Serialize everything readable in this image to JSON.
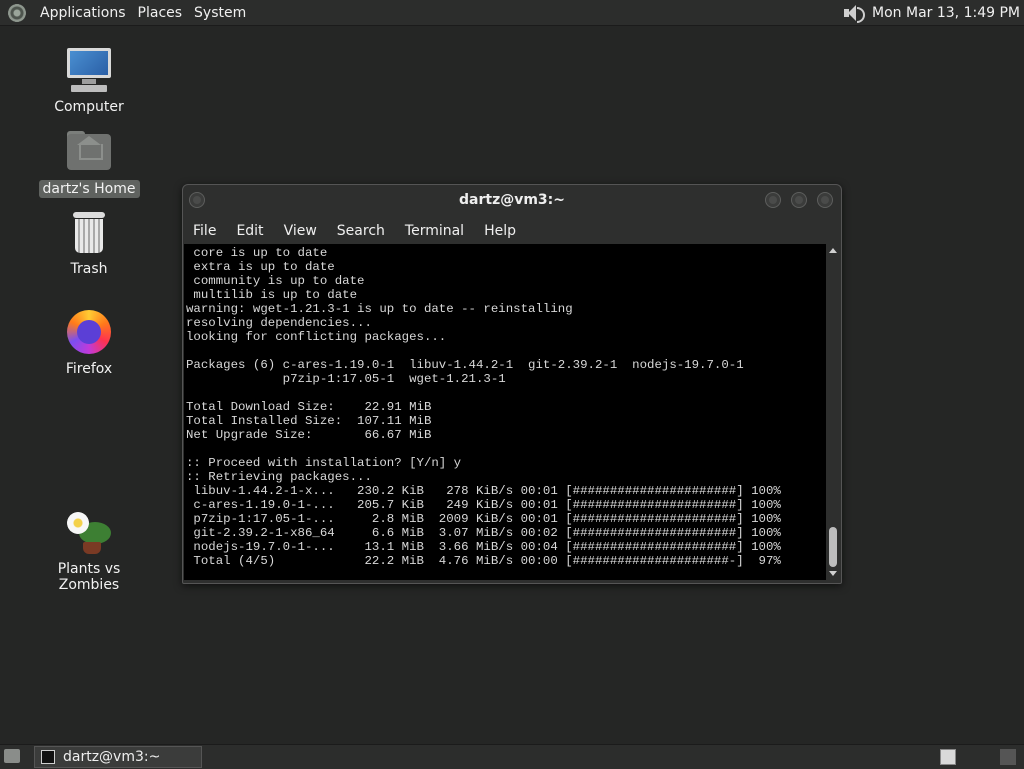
{
  "top_panel": {
    "menus": [
      "Applications",
      "Places",
      "System"
    ],
    "clock": "Mon Mar 13,  1:49 PM"
  },
  "desktop": {
    "icons": [
      {
        "label": "Computer",
        "icon": "computer-icon"
      },
      {
        "label": "dartz's Home",
        "icon": "home-folder-icon",
        "selected": true
      },
      {
        "label": "Trash",
        "icon": "trash-icon"
      },
      {
        "label": "Firefox",
        "icon": "firefox-icon"
      },
      {
        "label": "Plants vs Zombies",
        "icon": "plants-vs-zombies-icon"
      }
    ]
  },
  "terminal": {
    "title": "dartz@vm3:~",
    "menus": [
      "File",
      "Edit",
      "View",
      "Search",
      "Terminal",
      "Help"
    ],
    "output": " core is up to date\n extra is up to date\n community is up to date\n multilib is up to date\nwarning: wget-1.21.3-1 is up to date -- reinstalling\nresolving dependencies...\nlooking for conflicting packages...\n\nPackages (6) c-ares-1.19.0-1  libuv-1.44.2-1  git-2.39.2-1  nodejs-19.7.0-1\n             p7zip-1:17.05-1  wget-1.21.3-1\n\nTotal Download Size:    22.91 MiB\nTotal Installed Size:  107.11 MiB\nNet Upgrade Size:       66.67 MiB\n\n:: Proceed with installation? [Y/n] y\n:: Retrieving packages...\n libuv-1.44.2-1-x...   230.2 KiB   278 KiB/s 00:01 [######################] 100%\n c-ares-1.19.0-1-...   205.7 KiB   249 KiB/s 00:01 [######################] 100%\n p7zip-1:17.05-1-...     2.8 MiB  2009 KiB/s 00:01 [######################] 100%\n git-2.39.2-1-x86_64     6.6 MiB  3.07 MiB/s 00:02 [######################] 100%\n nodejs-19.7.0-1-...    13.1 MiB  3.66 MiB/s 00:04 [######################] 100%\n Total (4/5)            22.2 MiB  4.76 MiB/s 00:00 [#####################-]  97%"
  },
  "bottom_panel": {
    "task_label": "dartz@vm3:~"
  }
}
